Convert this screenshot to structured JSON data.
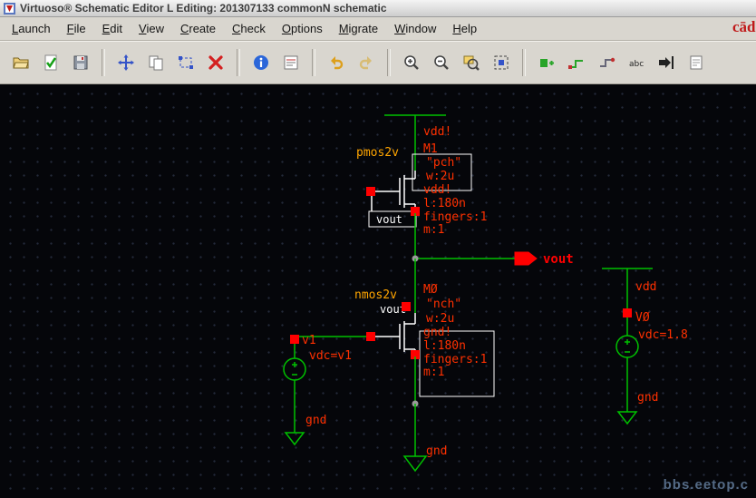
{
  "window": {
    "title": "Virtuoso® Schematic Editor L Editing: 201307133 commonN schematic"
  },
  "menubar": {
    "items": [
      "Launch",
      "File",
      "Edit",
      "View",
      "Create",
      "Check",
      "Options",
      "Migrate",
      "Window",
      "Help"
    ],
    "brand": "cādence"
  },
  "toolbar": {
    "abc_label": "abc",
    "buttons": [
      "open",
      "check-and-save",
      "save",
      "move",
      "copy",
      "stretch",
      "delete",
      "object-info",
      "properties",
      "undo",
      "redo",
      "zoom-in",
      "zoom-out",
      "zoom-to-fit",
      "fit-window",
      "create-instance",
      "create-wire",
      "create-wide-wire",
      "create-label",
      "create-pin",
      "create-note"
    ]
  },
  "schematic": {
    "top_net_label": "vdd!",
    "pmos": {
      "instance_type": "pmos2v",
      "name": "M1",
      "model": "\"pch\"",
      "width": "w:2u",
      "bulk": "vdd!",
      "length": "l:180n",
      "fingers": "fingers:1",
      "multiplier": "m:1",
      "gate_net": "vout"
    },
    "nmos": {
      "instance_type": "nmos2v",
      "name": "MØ",
      "model": "\"nch\"",
      "width": "w:2u",
      "bulk": "gnd!",
      "length": "l:180n",
      "fingers": "fingers:1",
      "multiplier": "m:1",
      "gate_net": "vout"
    },
    "v1": {
      "name": "v1",
      "value": "vdc=v1",
      "gnd_label": "gnd"
    },
    "v0": {
      "rail_label": "vdd",
      "name": "VØ",
      "value": "vdc=1.8",
      "gnd_label": "gnd"
    },
    "output_pin_label": "vout",
    "bottom_gnd_label": "gnd",
    "colors": {
      "wire_green": "#00c000",
      "selected_white": "#ffffff",
      "label_red": "#ff3000",
      "pin_red": "#ff0000",
      "instance_orange": "#ffa500",
      "canvas_bg": "#05060a"
    }
  },
  "watermark": "bbs.eetop.c"
}
